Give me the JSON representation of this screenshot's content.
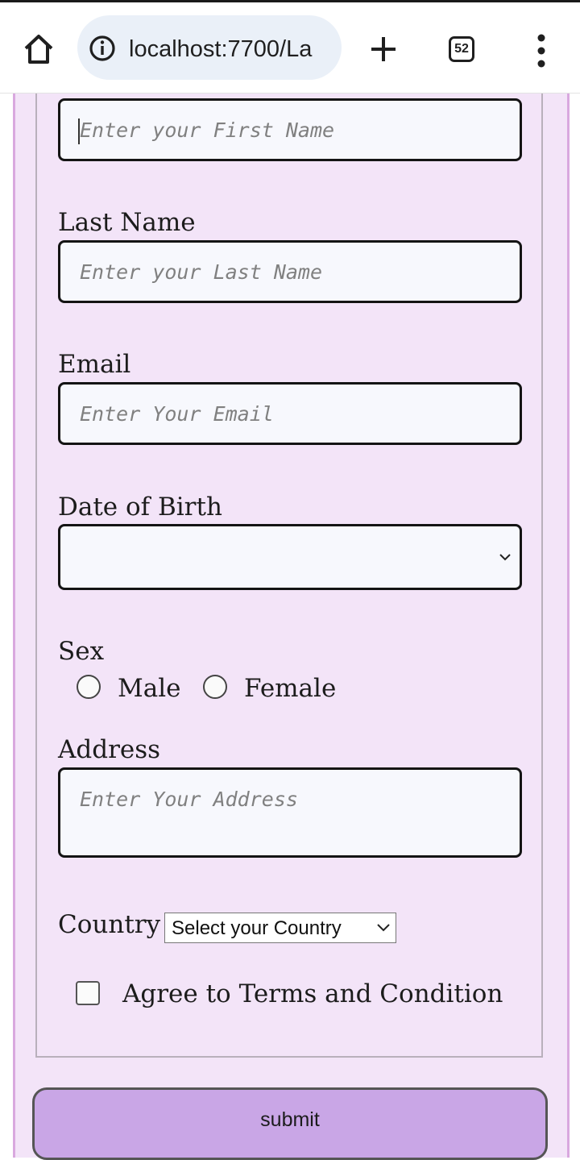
{
  "browser": {
    "url": "localhost:7700/La",
    "tab_count": "52"
  },
  "form": {
    "first_name_placeholder": "Enter your First Name",
    "last_name_label": "Last Name",
    "last_name_placeholder": "Enter your Last Name",
    "email_label": "Email",
    "email_placeholder": "Enter Your Email",
    "dob_label": "Date of Birth",
    "dob_value": "",
    "sex_label": "Sex",
    "sex_options": [
      "Male",
      "Female"
    ],
    "address_label": "Address",
    "address_placeholder": "Enter Your Address",
    "country_label": "Country",
    "country_selected": "Select your Country",
    "terms_label": "Agree to Terms and Condition",
    "submit_label": "submit"
  },
  "colors": {
    "page_bg": "#f3e4f8",
    "submit_bg": "#c9a6e6",
    "input_bg": "#f7f8fd"
  }
}
